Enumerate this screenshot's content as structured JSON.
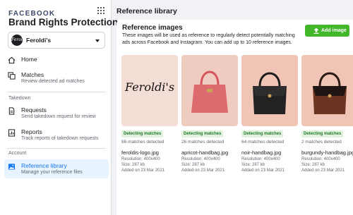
{
  "sidebar": {
    "brand": "FACEBOOK",
    "app_title": "Brand Rights Protection",
    "account": {
      "name": "Feroldi's",
      "avatar_text": "Feroldi's"
    },
    "items": [
      {
        "label": "Home",
        "sub": ""
      },
      {
        "label": "Matches",
        "sub": "Review detected ad matches"
      },
      {
        "label": "Requests",
        "sub": "Send takedown request for review"
      },
      {
        "label": "Reports",
        "sub": "Track reports of takedown requests"
      },
      {
        "label": "Reference library",
        "sub": "Manage your reference files"
      }
    ],
    "sections": {
      "takedown": "Takedown",
      "account": "Account"
    }
  },
  "main": {
    "page_title": "Reference library",
    "card": {
      "title": "Reference images",
      "description": "These images will be used as reference to regularly detect potentially matching ads across Facebook and Instagram. You can add up to 10 reference images.",
      "add_button": "Add image"
    },
    "images": [
      {
        "badge": "Detecting matches",
        "matches": "86 matches detected",
        "filename": "feroldis-logo.jpg",
        "resolution": "Resolution: 400x400",
        "size": "Size: 287 kb",
        "added": "Added on 23 Mar 2021",
        "logo_text": "Feroldi's"
      },
      {
        "badge": "Detecting matches",
        "matches": "26 matches detected",
        "filename": "apricot-handbag.jpg",
        "resolution": "Resolution: 400x400",
        "size": "Size: 287 kb",
        "added": "Added on 23 Mar 2021"
      },
      {
        "badge": "Detecting matches",
        "matches": "64 matches detected",
        "filename": "noir-handbag.jpg",
        "resolution": "Resolution: 400x400",
        "size": "Size: 287 kb",
        "added": "Added on 23 Mar 2021"
      },
      {
        "badge": "Detecting matches",
        "matches": "2 matches detected",
        "filename": "burgundy-handbag.jpg",
        "resolution": "Resolution: 400x400",
        "size": "Size: 287 kb",
        "added": "Added on 23 Mar 2021"
      }
    ]
  },
  "colors": {
    "accent": "#1877f2",
    "add_button": "#42b72a",
    "badge_bg": "#e3f1df",
    "badge_text": "#1e7a29"
  },
  "icons": [
    "grid-icon",
    "home-icon",
    "matches-icon",
    "requests-icon",
    "reports-icon",
    "reference-library-icon",
    "upload-icon"
  ]
}
